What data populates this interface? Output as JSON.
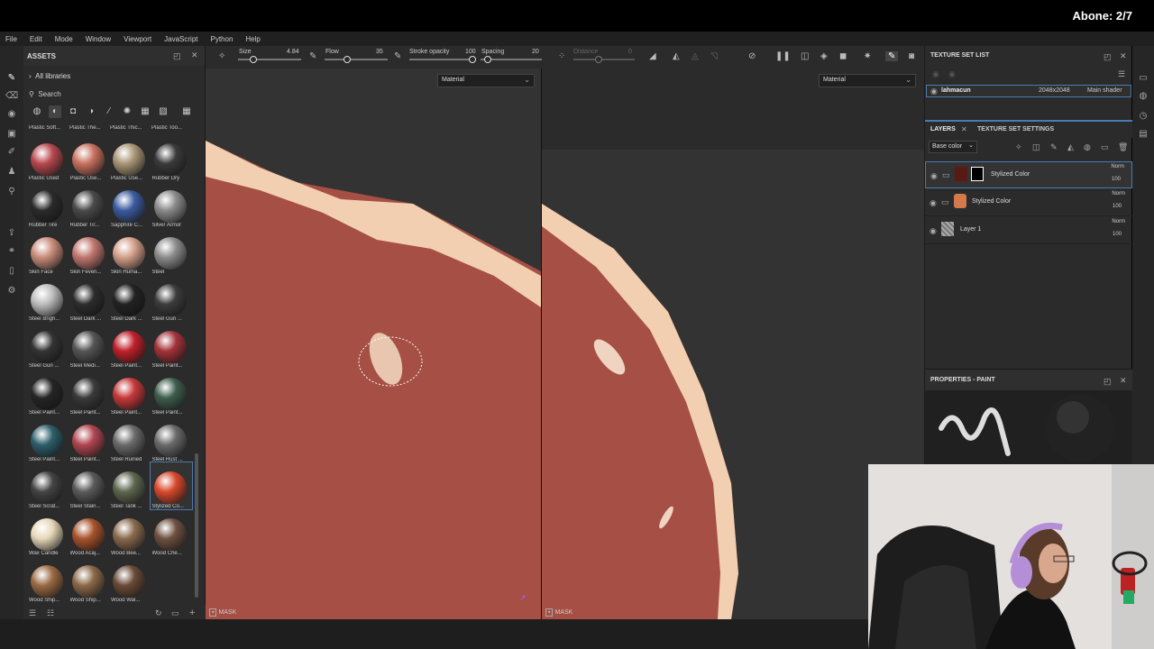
{
  "overlay": {
    "counter": "Abone: 2/7"
  },
  "menu": [
    "File",
    "Edit",
    "Mode",
    "Window",
    "Viewport",
    "JavaScript",
    "Python",
    "Help"
  ],
  "assets": {
    "title": "ASSETS",
    "library": "All libraries",
    "search_placeholder": "Search",
    "top_labels": [
      "Plastic Soft...",
      "Plastic The...",
      "Plastic Thic...",
      "Plastic Too..."
    ],
    "materials": [
      {
        "label": "Plastic Used",
        "color": "#b7484f"
      },
      {
        "label": "Plastic Use...",
        "color": "#c8705f"
      },
      {
        "label": "Plastic Use...",
        "color": "#a89575"
      },
      {
        "label": "Rubber Dry",
        "color": "#3a3a3a"
      },
      {
        "label": "Rubber Tire",
        "color": "#2a2a2a"
      },
      {
        "label": "Rubber Tir...",
        "color": "#4a4a4a"
      },
      {
        "label": "Sapphire C...",
        "color": "#3b5b9e"
      },
      {
        "label": "Silver Armor",
        "color": "#8a8a8a"
      },
      {
        "label": "Skin Face",
        "color": "#c98c7a"
      },
      {
        "label": "Skin Feveri...",
        "color": "#c0776f"
      },
      {
        "label": "Skin Huma...",
        "color": "#d4a08a"
      },
      {
        "label": "Steel",
        "color": "#8c8c8c"
      },
      {
        "label": "Steel Brigh...",
        "color": "#bdbdbd"
      },
      {
        "label": "Steel Dark ...",
        "color": "#2c2c2c"
      },
      {
        "label": "Steel Dark ...",
        "color": "#222222"
      },
      {
        "label": "Steel Gun ...",
        "color": "#3c3c3c"
      },
      {
        "label": "Steel Gun ...",
        "color": "#333333"
      },
      {
        "label": "Steel Medi...",
        "color": "#555555"
      },
      {
        "label": "Steel Paint...",
        "color": "#c0202a"
      },
      {
        "label": "Steel Paint...",
        "color": "#a3323a"
      },
      {
        "label": "Steel Paint...",
        "color": "#252525"
      },
      {
        "label": "Steel Paint...",
        "color": "#3a3a3a"
      },
      {
        "label": "Steel Paint...",
        "color": "#c7383a"
      },
      {
        "label": "Steel Paint...",
        "color": "#3e5d4c"
      },
      {
        "label": "Steel Paint...",
        "color": "#2d5e6a"
      },
      {
        "label": "Steel Paint...",
        "color": "#b04550"
      },
      {
        "label": "Steel Ruined",
        "color": "#6a6a6a"
      },
      {
        "label": "Steel Rust ...",
        "color": "#6a6a6a"
      },
      {
        "label": "Steel Scrat...",
        "color": "#444444"
      },
      {
        "label": "Steel Stain...",
        "color": "#5a5a5a"
      },
      {
        "label": "Steel Tank ...",
        "color": "#5e6650"
      },
      {
        "label": "Stylized Co...",
        "color": "#d8492c"
      },
      {
        "label": "Wax Candle",
        "color": "#e6d8b8"
      },
      {
        "label": "Wood Acaj...",
        "color": "#a8532c"
      },
      {
        "label": "Wood Bee...",
        "color": "#8a6a4e"
      },
      {
        "label": "Wood Che...",
        "color": "#6e5040"
      },
      {
        "label": "Wood Ship...",
        "color": "#9a6a44"
      },
      {
        "label": "Wood Ship...",
        "color": "#8a6848"
      },
      {
        "label": "Wood Wal...",
        "color": "#6a4a36"
      }
    ],
    "selected_label": "Stylized Co..."
  },
  "toolbar": {
    "size_label": "Size",
    "size_value": "4.84",
    "flow_label": "Flow",
    "flow_value": "35",
    "opacity_label": "Stroke opacity",
    "opacity_value": "100",
    "spacing_label": "Spacing",
    "spacing_value": "20",
    "distance_label": "Distance",
    "distance_value": "0"
  },
  "viewport": {
    "left_dropdown": "Material",
    "right_dropdown": "Material",
    "mask_label": "MASK"
  },
  "texture_set": {
    "title": "TEXTURE SET LIST",
    "name": "lahmacun",
    "size": "2048x2048",
    "shader": "Main shader"
  },
  "layers": {
    "tab_layers": "LAYERS",
    "tab_settings": "TEXTURE SET SETTINGS",
    "channel": "Base color",
    "items": [
      {
        "name": "Stylized Color",
        "blend": "Norm",
        "opacity": "100"
      },
      {
        "name": "Stylized Color",
        "blend": "Norm",
        "opacity": "100"
      },
      {
        "name": "Layer 1",
        "blend": "Norm",
        "opacity": "100"
      }
    ]
  },
  "properties": {
    "title": "PROPERTIES - PAINT"
  }
}
